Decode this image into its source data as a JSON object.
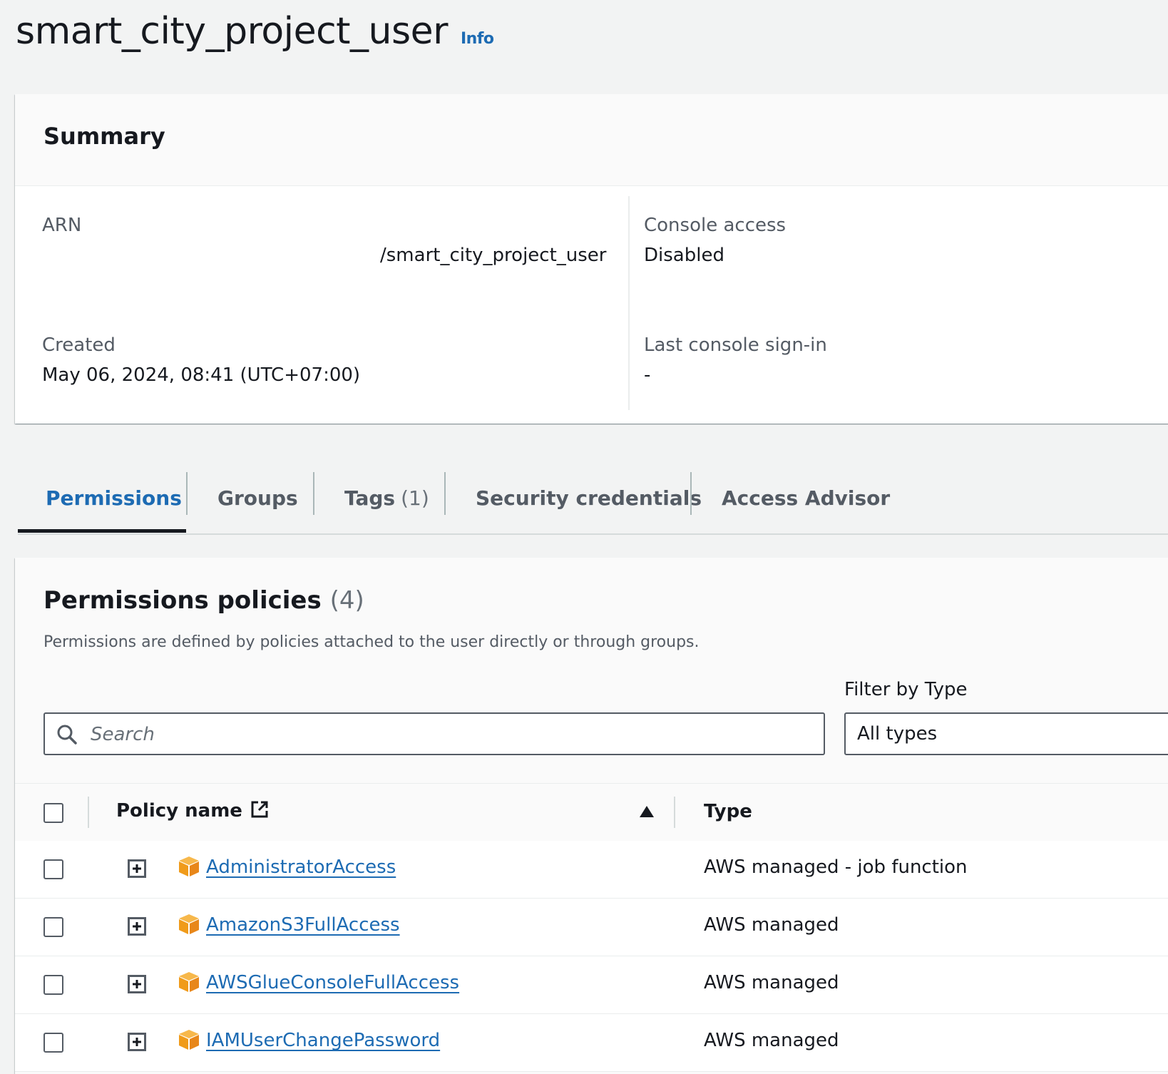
{
  "header": {
    "title": "smart_city_project_user",
    "info_label": "Info"
  },
  "summary": {
    "title": "Summary",
    "arn_label": "ARN",
    "arn_value": "/smart_city_project_user",
    "created_label": "Created",
    "created_value": "May 06, 2024, 08:41 (UTC+07:00)",
    "console_access_label": "Console access",
    "console_access_value": "Disabled",
    "last_signin_label": "Last console sign-in",
    "last_signin_value": "-"
  },
  "tabs": [
    {
      "label": "Permissions",
      "count": ""
    },
    {
      "label": "Groups",
      "count": ""
    },
    {
      "label": "Tags",
      "count": "(1)"
    },
    {
      "label": "Security credentials",
      "count": ""
    },
    {
      "label": "Access Advisor",
      "count": ""
    }
  ],
  "policies": {
    "title": "Permissions policies",
    "count": "(4)",
    "description": "Permissions are defined by policies attached to the user directly or through groups.",
    "search_placeholder": "Search",
    "filter_label": "Filter by Type",
    "filter_value": "All types",
    "col_policy_name": "Policy name",
    "col_type": "Type",
    "rows": [
      {
        "name": "AdministratorAccess",
        "type": "AWS managed - job function"
      },
      {
        "name": "AmazonS3FullAccess",
        "type": "AWS managed"
      },
      {
        "name": "AWSGlueConsoleFullAccess",
        "type": "AWS managed"
      },
      {
        "name": "IAMUserChangePassword",
        "type": "AWS managed"
      }
    ]
  },
  "colors": {
    "link": "#1d6bb3",
    "text": "#16191f",
    "muted": "#545b64",
    "aws_orange": "#f09b1a",
    "background": "#f2f3f3"
  }
}
